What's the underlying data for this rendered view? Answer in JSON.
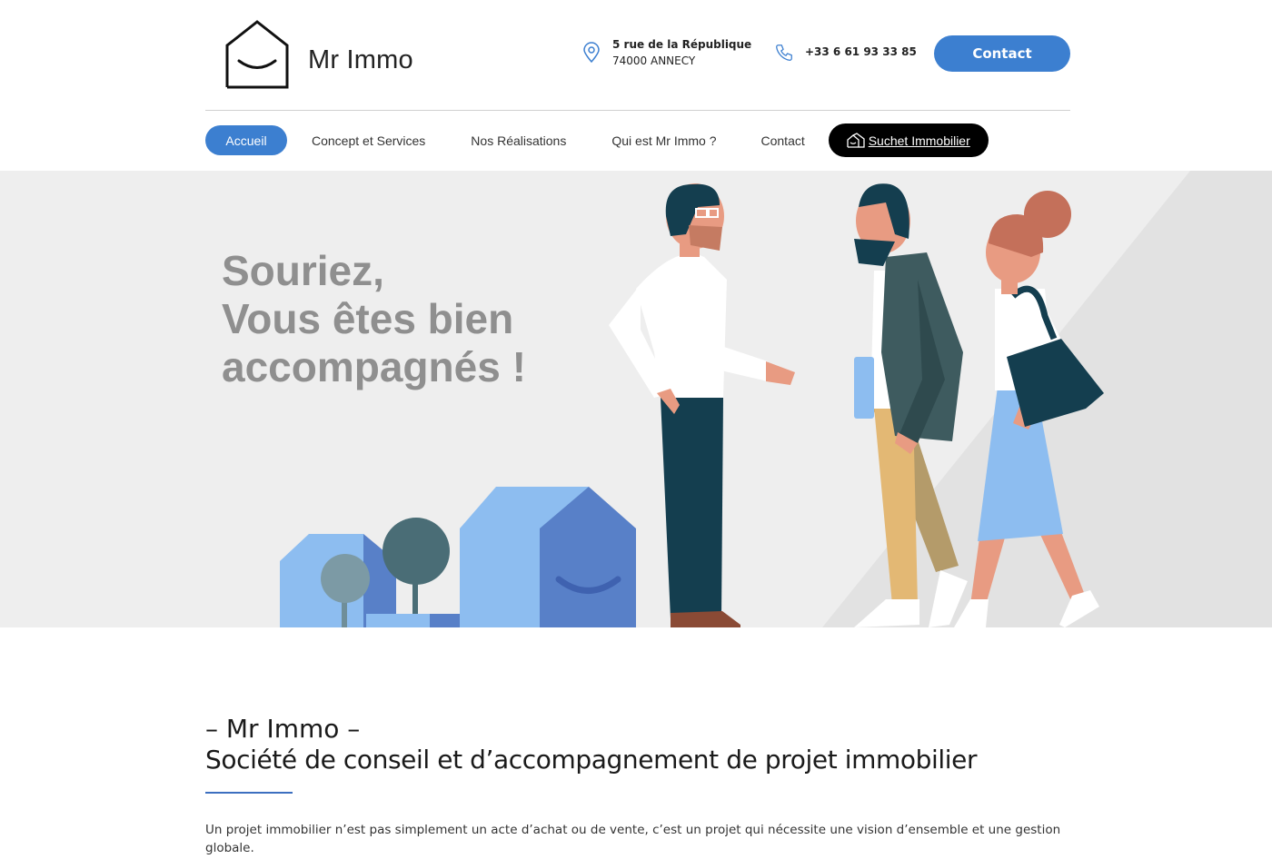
{
  "brand": {
    "name": "Mr Immo"
  },
  "header": {
    "address_line1": "5 rue de la République",
    "address_line2": "74000 ANNECY",
    "phone": "+33 6 61 93 33 85",
    "contact_button": "Contact"
  },
  "nav": {
    "items": [
      {
        "label": "Accueil",
        "active": true
      },
      {
        "label": "Concept et Services",
        "active": false
      },
      {
        "label": "Nos Réalisations",
        "active": false
      },
      {
        "label": "Qui est Mr Immo ?",
        "active": false
      },
      {
        "label": "Contact",
        "active": false
      }
    ],
    "special": {
      "label": "Suchet Immobilier",
      "icon": "house-icon"
    }
  },
  "hero": {
    "title_line1": "Souriez,",
    "title_line2": "Vous êtes bien",
    "title_line3": "accompagnés !"
  },
  "intro": {
    "heading_line1": "– Mr Immo –",
    "heading_line2": "Société de conseil et d’accompagnement de projet immobilier",
    "paragraph": "Un projet immobilier n’est pas simplement un acte d’achat ou de vente, c’est un projet qui nécessite une vision d’ensemble et une gestion globale."
  },
  "colors": {
    "accent": "#3c7fd0",
    "hero_bg": "#eeeeee",
    "hero_title": "#8f8f8f",
    "dark_button": "#000000"
  }
}
